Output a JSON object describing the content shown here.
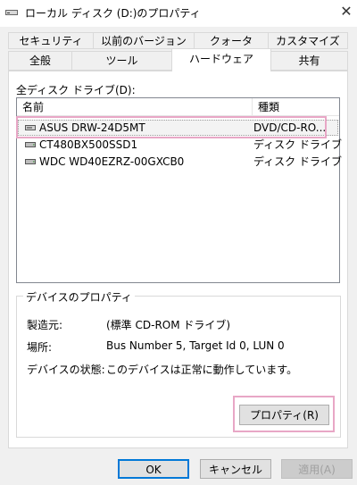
{
  "window": {
    "title": "ローカル ディスク (D:)のプロパティ",
    "close_glyph": "✕"
  },
  "tabs_top": [
    {
      "label": "セキュリティ"
    },
    {
      "label": "以前のバージョン"
    },
    {
      "label": "クォータ"
    },
    {
      "label": "カスタマイズ"
    }
  ],
  "tabs_bottom": [
    {
      "label": "全般"
    },
    {
      "label": "ツール"
    },
    {
      "label": "ハードウェア",
      "active": true
    },
    {
      "label": "共有"
    }
  ],
  "drives_section": {
    "label": "全ディスク ドライブ(D):",
    "columns": [
      "名前",
      "種類"
    ],
    "rows": [
      {
        "name": "ASUS DRW-24D5MT",
        "type": "DVD/CD-RO...",
        "icon": "optical-drive-icon",
        "selected": true
      },
      {
        "name": "CT480BX500SSD1",
        "type": "ディスク ドライブ",
        "icon": "disk-drive-icon"
      },
      {
        "name": "WDC WD40EZRZ-00GXCB0",
        "type": "ディスク ドライブ",
        "icon": "disk-drive-icon"
      }
    ]
  },
  "device_properties": {
    "title": "デバイスのプロパティ",
    "manufacturer_label": "製造元:",
    "manufacturer_value": "(標準 CD-ROM ドライブ)",
    "location_label": "場所:",
    "location_value": "Bus Number 5, Target Id 0, LUN 0",
    "status_label": "デバイスの状態:",
    "status_value": "このデバイスは正常に動作しています。",
    "properties_button": "プロパティ(R)"
  },
  "buttons": {
    "ok": "OK",
    "cancel": "キャンセル",
    "apply": "適用(A)"
  },
  "colors": {
    "highlight": "#e8a7c6",
    "default_button_border": "#0078d7"
  }
}
